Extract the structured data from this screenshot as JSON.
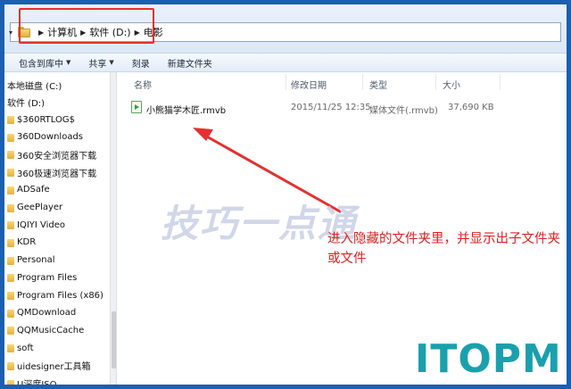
{
  "address": {
    "breadcrumbs": [
      "计算机",
      "软件 (D:)",
      "电影"
    ]
  },
  "toolbar": {
    "buttons": [
      {
        "label": "包含到库中",
        "dropdown": true
      },
      {
        "label": "共享",
        "dropdown": true
      },
      {
        "label": "刻录",
        "dropdown": false
      },
      {
        "label": "新建文件夹",
        "dropdown": false
      }
    ]
  },
  "nav": {
    "drives": [
      "本地磁盘 (C:)",
      "软件 (D:)"
    ],
    "folders": [
      "$360RTLOG$",
      "360Downloads",
      "360安全浏览器下载",
      "360极速浏览器下载",
      "ADSafe",
      "GeePlayer",
      "IQIYI Video",
      "KDR",
      "Personal",
      "Program Files",
      "Program Files (x86)",
      "QMDownload",
      "QQMusicCache",
      "soft",
      "uidesigner工具箱",
      "U深度ISO"
    ]
  },
  "list": {
    "columns": {
      "name": "名称",
      "modified": "修改日期",
      "type": "类型",
      "size": "大小"
    },
    "files": [
      {
        "name": "小熊猫学木匠.rmvb",
        "modified": "2015/11/25 12:35",
        "type": "媒体文件(.rmvb)",
        "size": "37,690 KB"
      }
    ]
  },
  "overlay": {
    "watermark": "技巧一点通",
    "annotation": "进入隐藏的文件夹里，并显示出子文件夹或文件",
    "logo": "ITOPM",
    "annotation_color": "#e02020",
    "logo_color": "#1aa0ad",
    "highlight_color": "#e53030"
  }
}
